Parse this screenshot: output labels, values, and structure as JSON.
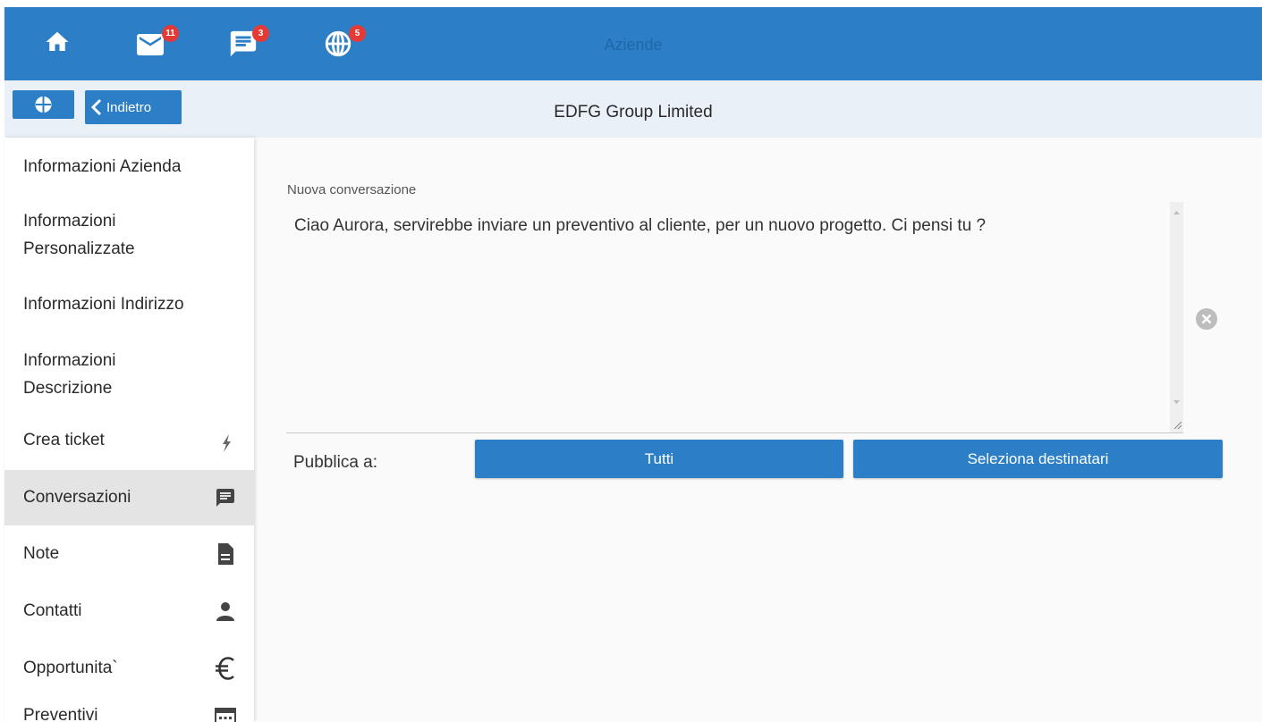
{
  "header": {
    "title": "Aziende",
    "badges": {
      "mail": "11",
      "chat": "3",
      "globe": "5"
    },
    "icons": [
      "home-icon",
      "mail-icon",
      "chat-icon",
      "globe-icon"
    ]
  },
  "subheader": {
    "back_label": "Indietro",
    "company_name": "EDFG Group Limited"
  },
  "sidebar": {
    "items": [
      {
        "label": "Informazioni Azienda"
      },
      {
        "label": "Informazioni Personalizzate"
      },
      {
        "label": "Informazioni Indirizzo"
      },
      {
        "label": "Informazioni Descrizione"
      },
      {
        "label": "Crea ticket",
        "icon": "lightning-icon"
      },
      {
        "label": "Conversazioni",
        "icon": "chat-icon",
        "active": true
      },
      {
        "label": "Note",
        "icon": "document-icon"
      },
      {
        "label": "Contatti",
        "icon": "person-icon"
      },
      {
        "label": "Opportunita`",
        "icon": "euro-icon"
      },
      {
        "label": "Preventivi",
        "icon": "calculator-icon"
      }
    ]
  },
  "conversation": {
    "label": "Nuova conversazione",
    "text": "Ciao Aurora, servirebbe inviare un preventivo al cliente, per un nuovo progetto. Ci pensi tu ?",
    "publish_label": "Pubblica a:",
    "btn_all": "Tutti",
    "btn_select": "Seleziona destinatari"
  },
  "colors": {
    "primary": "#2c7fc6",
    "subbar": "#e9f0f8",
    "badge": "#e53935",
    "active_item": "#e4e4e4"
  }
}
